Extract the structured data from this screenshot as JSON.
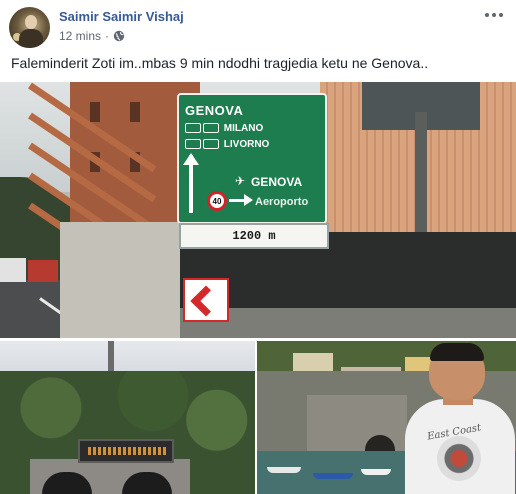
{
  "post": {
    "author": "Saimir Saimir Vishaj",
    "time": "12 mins",
    "separator": "·",
    "privacy_icon": "globe-icon",
    "more_icon": "more-options-icon",
    "text": "Faleminderit Zoti im..mbas 9 min ndodhi tragjedia ketu ne Genova..",
    "photos": [
      {
        "name": "highway-sign-photo",
        "sign": {
          "destination": "GENOVA",
          "route_1": "MILANO",
          "route_2": "LIVORNO",
          "exit_destination": "GENOVA",
          "exit_secondary": "Aeroporto",
          "speed_limit": "40",
          "distance": "1200 m"
        }
      },
      {
        "name": "tunnel-photo"
      },
      {
        "name": "harbor-selfie-photo",
        "shirt_text": "East Coast"
      }
    ]
  },
  "colors": {
    "author_link": "#385898",
    "meta_text": "#616770",
    "body_text": "#1d2129",
    "sign_green": "#1d7d4f"
  }
}
